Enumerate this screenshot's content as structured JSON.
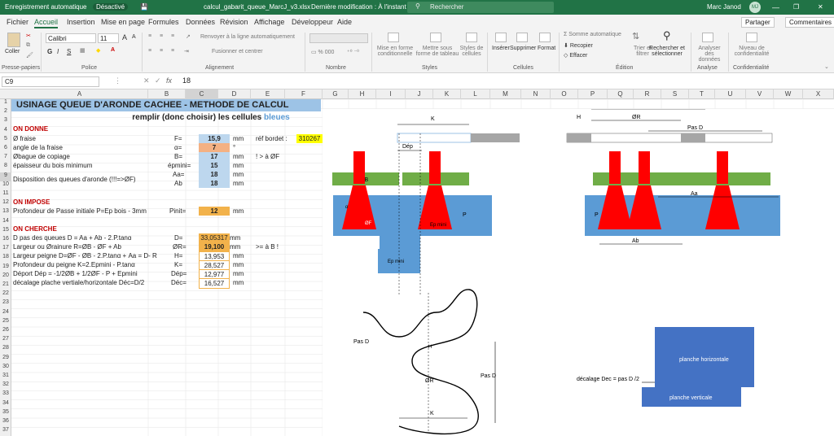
{
  "titlebar": {
    "autosave": "Enregistrement automatique",
    "autosave_state": "Désactivé",
    "filename": "calcul_gabarit_queue_MarcJ_v3.xlsx",
    "modified": "Dernière modification : À l'instant",
    "search": "Rechercher",
    "user": "Marc Janod",
    "initials": "MJ"
  },
  "tabs": [
    "Fichier",
    "Accueil",
    "Insertion",
    "Mise en page",
    "Formules",
    "Données",
    "Révision",
    "Affichage",
    "Développeur",
    "Aide"
  ],
  "share": {
    "partager": "Partager",
    "commentaires": "Commentaires"
  },
  "ribbon": {
    "clipboard": {
      "group": "Presse-papiers",
      "paste": "Coller"
    },
    "font": {
      "group": "Police",
      "name": "Calibri",
      "size": "11",
      "bold": "G",
      "italic": "I",
      "underline": "S",
      "grow": "A",
      "shrink": "A"
    },
    "alignment": {
      "group": "Alignement",
      "wrap": "Renvoyer à la ligne automatiquement",
      "merge": "Fusionner et centrer"
    },
    "number": {
      "group": "Nombre"
    },
    "styles": {
      "group": "Styles",
      "cond": "Mise en forme conditionnelle",
      "table": "Mettre sous forme de tableau",
      "cell": "Styles de cellules"
    },
    "cells": {
      "group": "Cellules",
      "insert": "Insérer",
      "delete": "Supprimer",
      "format": "Format"
    },
    "edit": {
      "group": "Édition",
      "autosum": "Somme automatique",
      "fill": "Recopier",
      "clear": "Effacer",
      "sort": "Trier et filtrer",
      "find": "Rechercher et sélectionner"
    },
    "analysis": {
      "group": "Analyse",
      "analyze": "Analyser des données"
    },
    "conf": {
      "group": "Confidentialité",
      "level": "Niveau de confidentialité"
    }
  },
  "formula_bar": {
    "cell": "C9",
    "fx": "fx",
    "value": "18"
  },
  "columns": [
    "A",
    "B",
    "C",
    "D",
    "E",
    "F",
    "G",
    "H",
    "I",
    "J",
    "K",
    "L",
    "M",
    "N",
    "O",
    "P",
    "Q",
    "R",
    "S",
    "T",
    "U",
    "V",
    "W",
    "X"
  ],
  "rows": [
    "1",
    "2",
    "3",
    "4",
    "5",
    "6",
    "7",
    "8",
    "9",
    "10",
    "11",
    "12",
    "13",
    "14",
    "15",
    "16",
    "17",
    "18",
    "19",
    "20",
    "21",
    "22",
    "23",
    "24",
    "25",
    "26",
    "27",
    "28",
    "29",
    "30",
    "31",
    "32",
    "33",
    "34",
    "35",
    "36",
    "37"
  ],
  "sheet": {
    "title": "USINAGE QUEUE D'ARONDE CACHEE - METHODE DE CALCUL",
    "subtitle": "remplir (donc choisir) les cellules",
    "subtitle_blue": "bleues",
    "s_donne": "ON DONNE",
    "s_impose": "ON IMPOSE",
    "s_cherche": "ON CHERCHE",
    "r4": {
      "a": "Ø fraise",
      "b": "F=",
      "c": "15,9",
      "d": "mm",
      "e": "réf bordet :",
      "f": "310267"
    },
    "r5": {
      "a": "angle de la fraise",
      "b": "α=",
      "c": "7",
      "d": "°"
    },
    "r6": {
      "a": "Øbague de copiage",
      "b": "B=",
      "c": "17",
      "d": "mm",
      "e": "! > à ØF"
    },
    "r7": {
      "a": "épaisseur du bois minimum",
      "b": "épmini=",
      "c": "15",
      "d": "mm"
    },
    "r8": {
      "a": "Disposition des queues d'aronde (!!!=>ØF)",
      "b1": "Aa=",
      "c1": "18",
      "d1": "mm",
      "b2": "Ab",
      "c2": "18",
      "d2": "mm"
    },
    "r12": {
      "a": "Profondeur de Passe initiale P=Ep bois - 3mm",
      "b": "Pinit=",
      "c": "12",
      "d": "mm"
    },
    "r15": {
      "a": "D pas des queues D = Aa + Ab - 2.P.tanα",
      "b": "D=",
      "c": "33,05317",
      "d": "mm"
    },
    "r16": {
      "a": "Largeur ou Ørainure R=ØB - ØF + Ab",
      "b": "ØR=",
      "c": "19,100",
      "d": "mm",
      "e": ">= à B !"
    },
    "r17": {
      "a": "Largeur  peigne D=ØF - ØB - 2.P.tanα + Aa = D- R",
      "b": "H=",
      "c": "13,953",
      "d": "mm"
    },
    "r18": {
      "a": "Profondeur du peigne K=2.Epmini - P.tanα",
      "b": "K=",
      "c": "28,527",
      "d": "mm"
    },
    "r19": {
      "a": "Déport Dép = -1/2ØB + 1/2ØF - P + Epmini",
      "b": "Dép=",
      "c": "12,977",
      "d": "mm"
    },
    "r20": {
      "a": "décalage plache vertiale/horizontale Déc=D/2",
      "b": "Déc=",
      "c": "16,527",
      "d": "mm"
    }
  },
  "drawing": {
    "k": "K",
    "dep": "Dép",
    "ob": "ØB",
    "p": "P",
    "of": "ØF",
    "epmini": "Ep mini",
    "alpha": "α",
    "h": "H",
    "or": "ØR",
    "pasd": "Pas D",
    "aa": "Aa",
    "ab": "Ab",
    "ep_mini2": "Ep mini",
    "pas_d_left": "Pas D",
    "h2": "H",
    "or2": "ØR",
    "pas_d_right": "Pas D",
    "k2": "K",
    "planche_h": "planche horizontale",
    "planche_v": "planche verticale",
    "decalage": "décalage Dec = pas D /2"
  },
  "colors": {
    "green": "#217346",
    "blue_fill": "#5b9bd5",
    "light_blue": "#bdd7ee",
    "red": "#ff0000",
    "green_block": "#70ad47",
    "orange": "#f4b183",
    "gold": "#f2b24b",
    "yellow": "#ffff00",
    "header_blue": "#9dc3e6",
    "planche": "#4472c4"
  }
}
